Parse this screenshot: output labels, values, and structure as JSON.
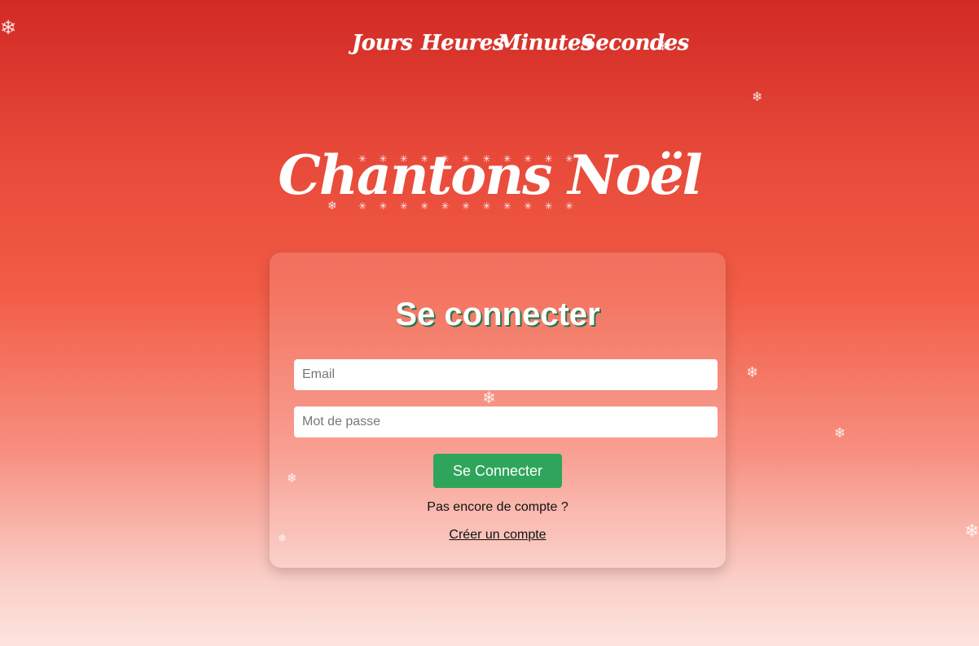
{
  "countdown": {
    "jours": "Jours",
    "heures": "Heures",
    "minutes": "Minutes",
    "secondes": "Secondes"
  },
  "site_title": "Chantons Noël",
  "login": {
    "title": "Se connecter",
    "email_placeholder": "Email",
    "password_placeholder": "Mot de passe",
    "submit_label": "Se Connecter",
    "no_account_text": "Pas encore de compte ?",
    "create_account_link": "Créer un compte"
  },
  "snowflake_glyph": "❄",
  "colors": {
    "background_top": "#d12a25",
    "background_bottom": "#fde3de",
    "button_green": "#2ea55a",
    "title_shadow": "#1f7a4c"
  }
}
